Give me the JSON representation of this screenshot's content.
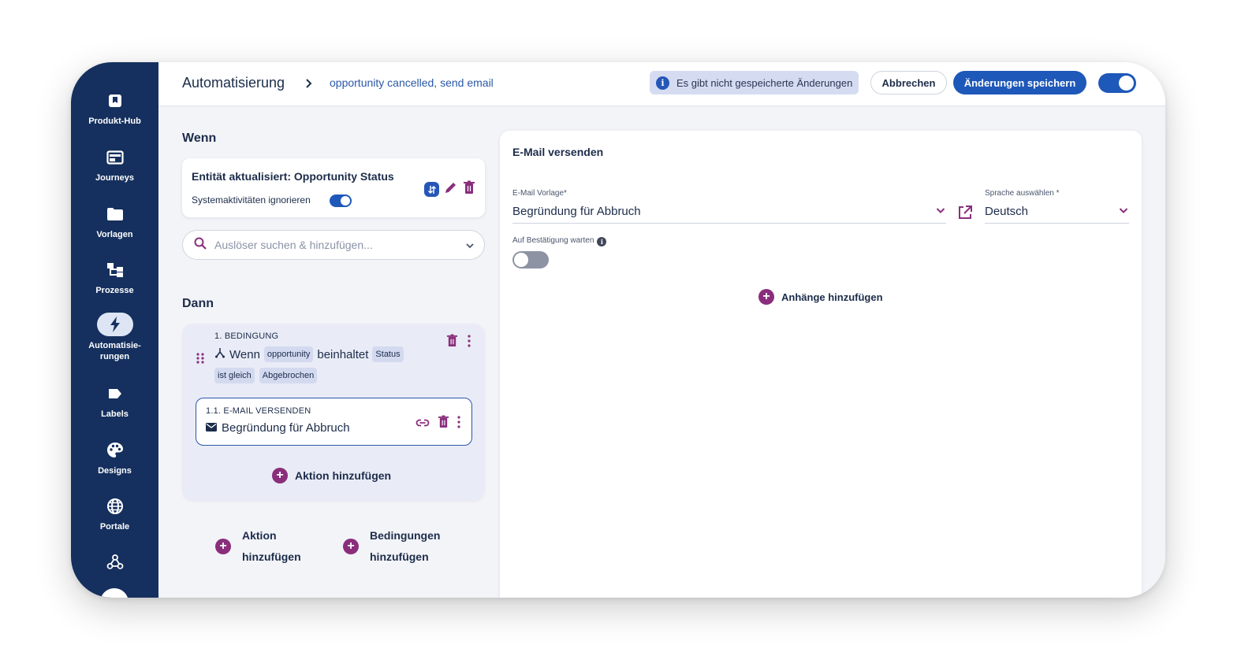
{
  "sidebar": {
    "items": [
      {
        "label": "Produkt-Hub",
        "icon": "bookmark-icon"
      },
      {
        "label": "Journeys",
        "icon": "journeys-icon"
      },
      {
        "label": "Vorlagen",
        "icon": "folder-icon"
      },
      {
        "label": "Prozesse",
        "icon": "process-icon"
      },
      {
        "label": "Automatisie-\nrungen",
        "icon": "lightning-icon",
        "active": true
      },
      {
        "label": "Labels",
        "icon": "label-icon"
      },
      {
        "label": "Designs",
        "icon": "palette-icon"
      },
      {
        "label": "Portale",
        "icon": "globe-icon"
      },
      {
        "label": "",
        "icon": "webhook-icon"
      }
    ]
  },
  "header": {
    "breadcrumb_root": "Automatisierung",
    "breadcrumb_leaf": "opportunity cancelled, send email",
    "unsaved_notice": "Es gibt nicht gespeicherte Änderungen",
    "cancel_label": "Abbrechen",
    "save_label": "Änderungen speichern",
    "active_toggle_on": true
  },
  "wenn": {
    "title": "Wenn",
    "trigger_title": "Entität aktualisiert: Opportunity Status",
    "ignore_system_label": "Systemaktivitäten ignorieren",
    "ignore_system_on": true,
    "search_placeholder": "Auslöser suchen & hinzufügen..."
  },
  "dann": {
    "title": "Dann",
    "condition": {
      "label": "1. BEDINGUNG",
      "word_if": "Wenn",
      "entity": "opportunity",
      "word_contains": "beinhaltet",
      "field": "Status",
      "operator": "ist gleich",
      "value": "Abgebrochen"
    },
    "action": {
      "label": "1.1. E-MAIL VERSENDEN",
      "template": "Begründung für Abbruch"
    },
    "add_action_label": "Aktion hinzufügen",
    "bottom_add_action": [
      "Aktion",
      "hinzufügen"
    ],
    "bottom_add_conditions": [
      "Bedingungen",
      "hinzufügen"
    ]
  },
  "panel": {
    "title": "E-Mail versenden",
    "template_label": "E-Mail Vorlage*",
    "template_value": "Begründung für Abbruch",
    "language_label": "Sprache auswählen *",
    "language_value": "Deutsch",
    "await_confirmation_label": "Auf Bestätigung warten",
    "await_confirmation_on": false,
    "add_attachments_label": "Anhänge hinzufügen"
  },
  "colors": {
    "sidebar_bg": "#15305e",
    "primary": "#1e58b9",
    "accent_purple": "#8a2e7c",
    "chip_bg": "#d3daf0",
    "notice_bg": "#d5dcf2"
  }
}
